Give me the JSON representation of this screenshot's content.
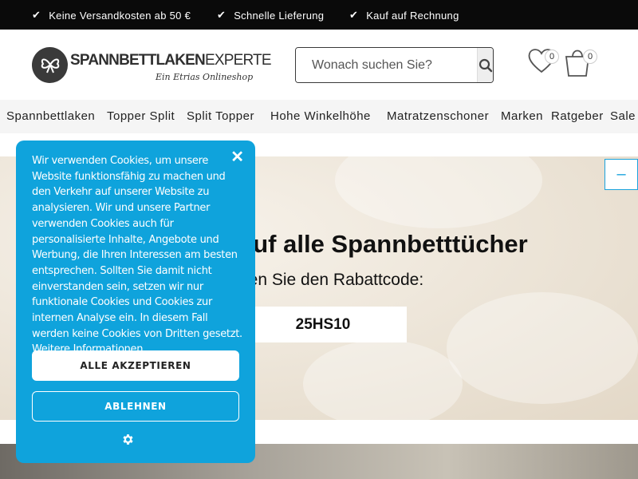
{
  "topbar": {
    "usps": [
      {
        "label": "Keine Versandkosten ab 50 €",
        "icon": "check-icon"
      },
      {
        "label": "Schnelle Lieferung",
        "icon": "check-icon"
      },
      {
        "label": "Kauf auf Rechnung",
        "icon": "check-icon"
      }
    ]
  },
  "header": {
    "logo": {
      "brand_bold": "SPANNBETTLAKEN",
      "brand_rest": "EXPERTE",
      "tagline": "Ein Etrias Onlineshop"
    },
    "search": {
      "placeholder": "Wonach suchen Sie?"
    },
    "wishlist": {
      "count": "0"
    },
    "cart": {
      "count": "0"
    }
  },
  "nav": {
    "items": [
      "Spannbettlaken",
      "Topper Split",
      "Split Topper",
      "Hohe Winkelhöhe",
      "Matratzenschoner",
      "Marken",
      "Ratgeber",
      "Sale"
    ]
  },
  "hero": {
    "title": "auf alle Spannbetttücher",
    "subtitle": "den Sie den Rabattcode:",
    "code": "25HS10",
    "toggle_label": "–"
  },
  "cookie": {
    "text": "Wir verwenden Cookies, um unsere Website funktionsfähig zu machen und den Verkehr auf unserer Website zu analysieren. Wir und unsere Partner verwenden Cookies auch für personalisierte Inhalte, Angebote und Werbung, die Ihren Interessen am besten entsprechen. Sollten Sie damit nicht einverstanden sein, setzen wir nur funktionale Cookies und Cookies zur internen Analyse ein. In diesem Fall werden keine Cookies von Dritten gesetzt. Weitere Informationen",
    "accept_label": "ALLE AKZEPTIEREN",
    "decline_label": "ABLEHNEN",
    "close_label": "✕",
    "settings_icon": "gear-icon"
  },
  "colors": {
    "accent": "#0fa3dc",
    "topbar": "#0a0a0a"
  }
}
